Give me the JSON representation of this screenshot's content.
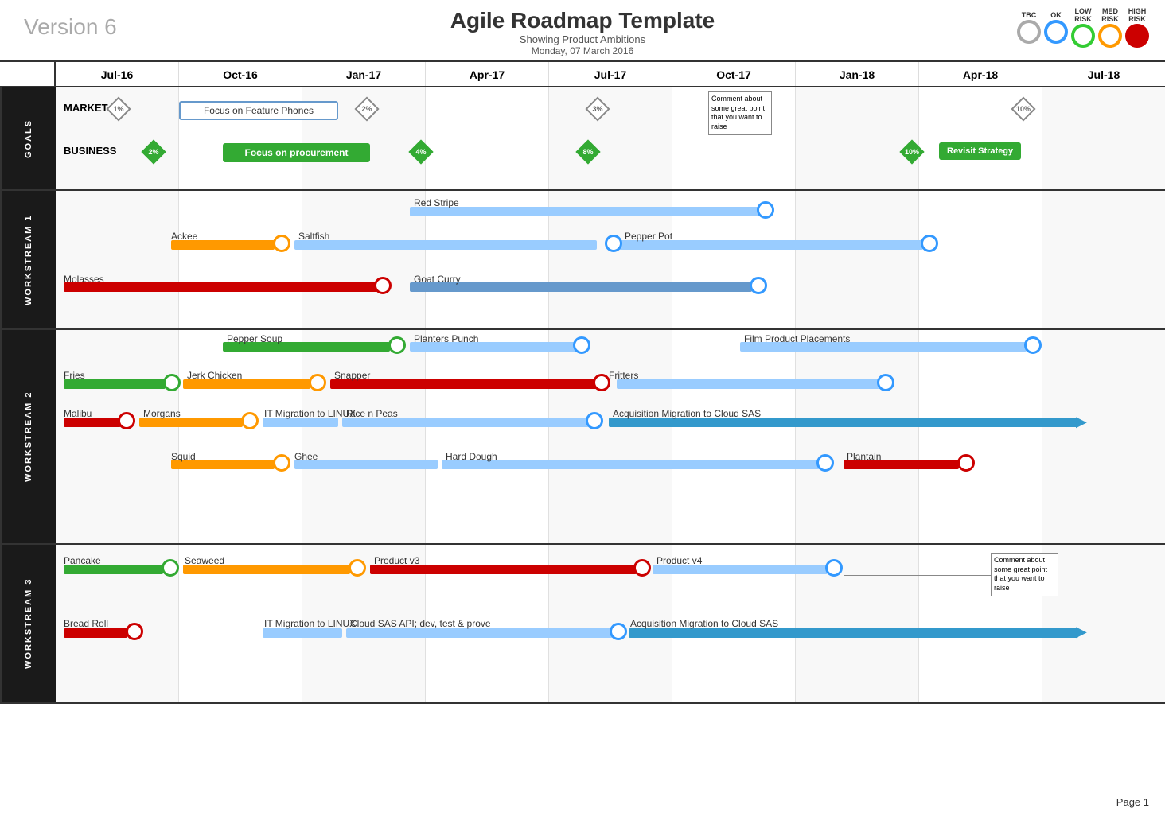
{
  "page": {
    "version": "Version 6",
    "title": "Agile Roadmap Template",
    "subtitle": "Showing Product Ambitions",
    "date": "Monday, 07 March 2016",
    "page_number": "Page 1"
  },
  "legend": {
    "tbc": "TBC",
    "ok": "OK",
    "low_risk": "LOW\nRISK",
    "med_risk": "MED\nRISK",
    "high_risk": "HIGH\nRISK"
  },
  "timeline": {
    "columns": [
      "Jul-16",
      "Oct-16",
      "Jan-17",
      "Apr-17",
      "Jul-17",
      "Oct-17",
      "Jan-18",
      "Apr-18",
      "Jul-18"
    ]
  },
  "sections": {
    "goals": "GOALS",
    "ws1": "WORKSTREAM 1",
    "ws2": "WORKSTREAM 2",
    "ws3": "WORKSTREAM 3"
  },
  "goals": {
    "market_label": "MARKET",
    "business_label": "BUSINESS",
    "diamond_1pct": "1%",
    "diamond_2pct_market": "2%",
    "diamond_3pct": "3%",
    "diamond_10pct_right": "10%",
    "diamond_2pct_biz": "2%",
    "diamond_4pct": "4%",
    "diamond_8pct": "8%",
    "diamond_10pct_biz": "10%",
    "focus_feature": "Focus on Feature Phones",
    "focus_procurement": "Focus on procurement",
    "revisit_strategy": "Revisit Strategy",
    "comment_text": "Comment about some great point that you want to raise"
  },
  "ws1": {
    "items": [
      {
        "name": "Red Stripe",
        "color": "lightblue"
      },
      {
        "name": "Ackee",
        "color": "orange"
      },
      {
        "name": "Saltfish",
        "color": "lightblue"
      },
      {
        "name": "Pepper Pot",
        "color": "lightblue"
      },
      {
        "name": "Molasses",
        "color": "red"
      },
      {
        "name": "Goat Curry",
        "color": "blue"
      }
    ]
  },
  "ws2": {
    "items": [
      {
        "name": "Pepper Soup",
        "color": "green"
      },
      {
        "name": "Planters Punch",
        "color": "lightblue"
      },
      {
        "name": "Film Product Placements",
        "color": "lightblue"
      },
      {
        "name": "Fries",
        "color": "green"
      },
      {
        "name": "Jerk Chicken",
        "color": "orange"
      },
      {
        "name": "Snapper",
        "color": "red"
      },
      {
        "name": "Fritters",
        "color": "lightblue"
      },
      {
        "name": "Malibu",
        "color": "red"
      },
      {
        "name": "Morgans",
        "color": "orange"
      },
      {
        "name": "IT Migration to LINUX",
        "color": "lightblue"
      },
      {
        "name": "Rice n Peas",
        "color": "lightblue"
      },
      {
        "name": "Acquisition Migration to Cloud SAS",
        "color": "blue_arrow"
      },
      {
        "name": "Squid",
        "color": "orange"
      },
      {
        "name": "Ghee",
        "color": "lightblue"
      },
      {
        "name": "Hard Dough",
        "color": "lightblue"
      },
      {
        "name": "Plantain",
        "color": "red"
      }
    ]
  },
  "ws3": {
    "items": [
      {
        "name": "Pancake",
        "color": "green"
      },
      {
        "name": "Seaweed",
        "color": "orange"
      },
      {
        "name": "Product v3",
        "color": "red"
      },
      {
        "name": "Product v4",
        "color": "lightblue"
      },
      {
        "name": "Bread Roll",
        "color": "red"
      },
      {
        "name": "IT Migration to LINUX",
        "color": "lightblue"
      },
      {
        "name": "Cloud SAS API; dev, test & prove",
        "color": "lightblue"
      },
      {
        "name": "Acquisition Migration to Cloud SAS",
        "color": "blue_arrow"
      }
    ],
    "comment_text": "Comment about some great point that you want to raise"
  }
}
